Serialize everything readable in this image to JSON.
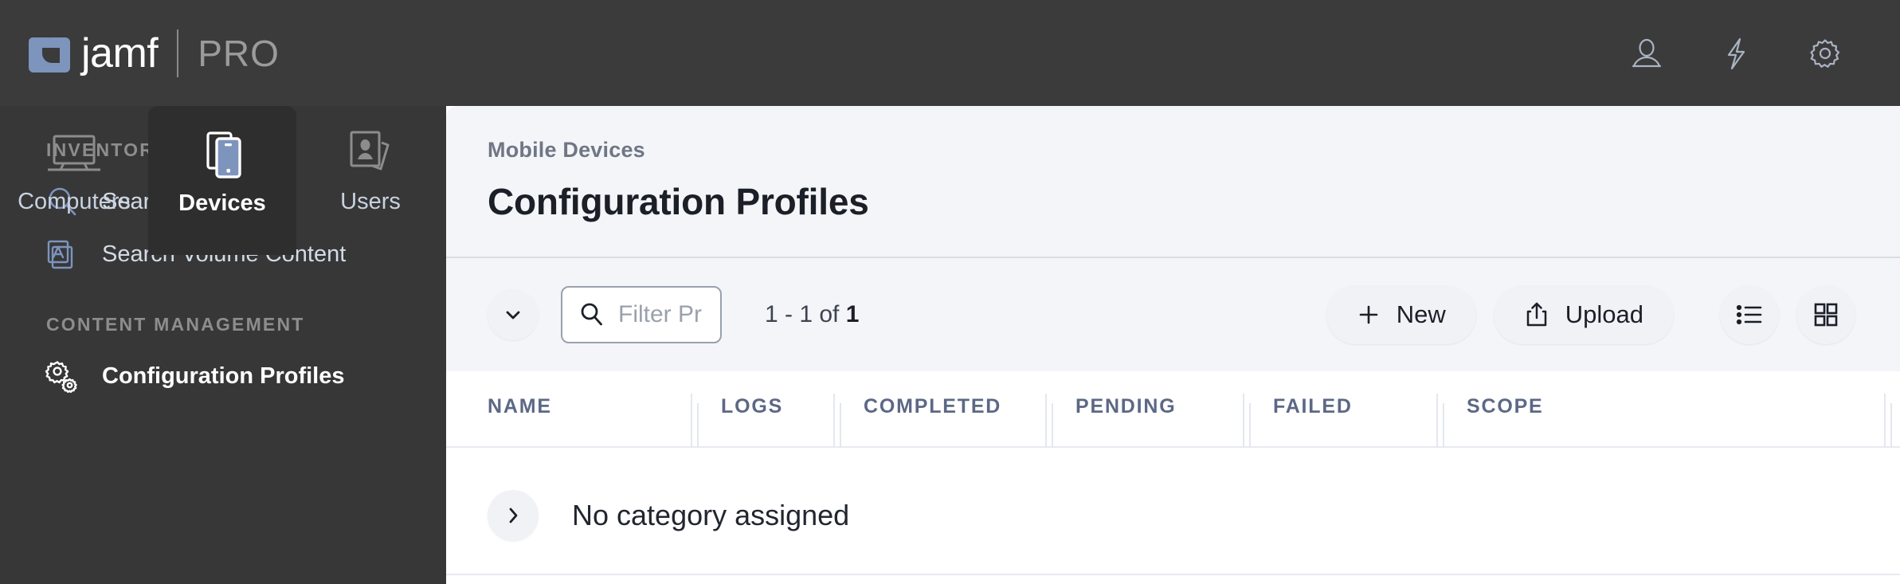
{
  "brand": {
    "name": "jamf",
    "product": "PRO",
    "logo_color": "#7d94bd"
  },
  "topbar": {
    "background": "#3b3b3b",
    "actions": [
      {
        "name": "user-icon",
        "label": "User"
      },
      {
        "name": "bolt-icon",
        "label": "Quick Actions"
      },
      {
        "name": "gear-icon",
        "label": "Settings"
      }
    ]
  },
  "tabs": [
    {
      "label": "Computers",
      "icon": "laptop-icon",
      "active": false
    },
    {
      "label": "Devices",
      "icon": "mobile-device-icon",
      "active": true
    },
    {
      "label": "Users",
      "icon": "user-card-icon",
      "active": false
    }
  ],
  "sidebar": {
    "sections": [
      {
        "title": "INVENTORY",
        "items": [
          {
            "label": "Search Inventory",
            "icon": "magnifier-icon",
            "active": false
          },
          {
            "label": "Search Volume Content",
            "icon": "app-store-icon",
            "active": false
          }
        ]
      },
      {
        "title": "CONTENT MANAGEMENT",
        "items": [
          {
            "label": "Configuration Profiles",
            "icon": "gears-icon",
            "active": true
          }
        ]
      }
    ]
  },
  "main": {
    "breadcrumb": "Mobile Devices",
    "title": "Configuration Profiles",
    "toolbar": {
      "collapse_icon": "chevron-down-icon",
      "filter_placeholder": "Filter Pr",
      "search_icon": "search-icon",
      "result_count_prefix": "1 - 1 of ",
      "result_count_total": "1",
      "new_label": "New",
      "new_icon": "plus-icon",
      "upload_label": "Upload",
      "upload_icon": "upload-icon",
      "list_view_icon": "list-view-icon",
      "grid_view_icon": "grid-view-icon"
    },
    "table": {
      "columns": [
        {
          "key": "name",
          "label": "NAME"
        },
        {
          "key": "logs",
          "label": "LOGS"
        },
        {
          "key": "completed",
          "label": "COMPLETED"
        },
        {
          "key": "pending",
          "label": "PENDING"
        },
        {
          "key": "failed",
          "label": "FAILED"
        },
        {
          "key": "scope",
          "label": "SCOPE"
        }
      ],
      "groups": [
        {
          "label": "No category assigned",
          "expanded": false,
          "expand_icon": "chevron-right-icon"
        }
      ]
    }
  },
  "colors": {
    "panel_bg": "#f4f5f8",
    "rail_bg": "#373737",
    "tab_active_bg": "#2e2e2e",
    "header_text": "#5c6885",
    "accent_blue": "#7d94bd"
  }
}
